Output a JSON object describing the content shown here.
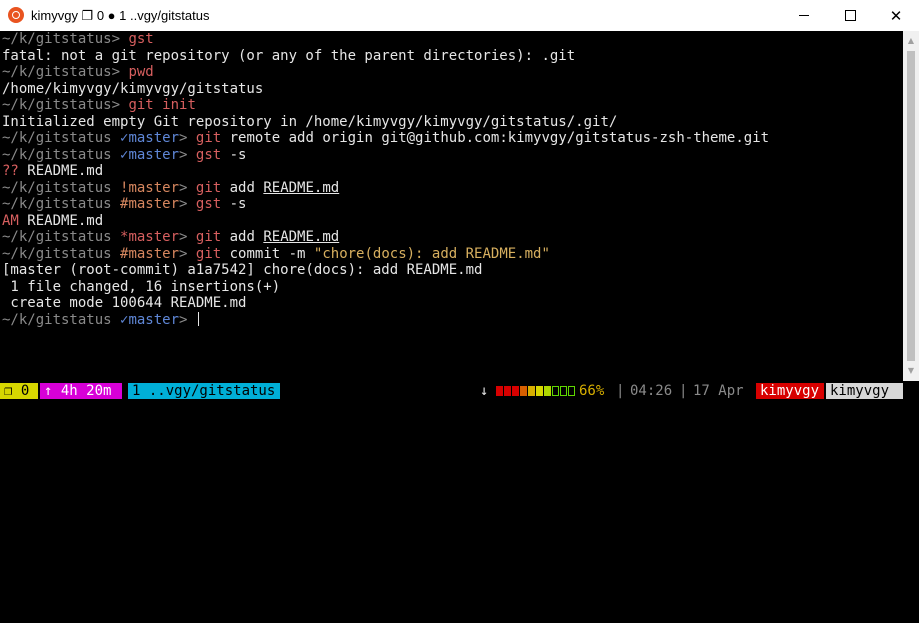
{
  "window": {
    "title": "kimyvgy ❐ 0 ● 1 ..vgy/gitstatus",
    "controls": {
      "minimize": "minimize",
      "maximize": "maximize",
      "close": "✕"
    }
  },
  "terminal": {
    "lines": [
      {
        "prompt": "~/k/gitstatus",
        "branch_mark": "",
        "branch": "",
        "sep": "> ",
        "cmd": "gst",
        "rest": ""
      },
      {
        "text": "fatal: not a git repository (or any of the parent directories): .git"
      },
      {
        "prompt": "~/k/gitstatus",
        "branch_mark": "",
        "branch": "",
        "sep": "> ",
        "cmd": "pwd",
        "rest": ""
      },
      {
        "text": "/home/kimyvgy/kimyvgy/gitstatus"
      },
      {
        "prompt": "~/k/gitstatus",
        "branch_mark": "",
        "branch": "",
        "sep": "> ",
        "cmd": "git init",
        "rest": ""
      },
      {
        "text": "Initialized empty Git repository in /home/kimyvgy/kimyvgy/gitstatus/.git/"
      },
      {
        "prompt": "~/k/gitstatus ",
        "branch_mark": "✓",
        "branch": "master",
        "sep": "> ",
        "cmd": "git",
        "rest": " remote add origin git@github.com:kimyvgy/gitstatus-zsh-theme.git"
      },
      {
        "prompt": "~/k/gitstatus ",
        "branch_mark": "✓",
        "branch": "master",
        "sep": "> ",
        "cmd": "gst",
        "rest": " -s"
      },
      {
        "status_code": "??",
        "file": " README.md"
      },
      {
        "prompt": "~/k/gitstatus ",
        "branch_mark": "!",
        "branch": "master",
        "sep": "> ",
        "cmd": "git",
        "rest": " add ",
        "arg": "README.md"
      },
      {
        "prompt": "~/k/gitstatus ",
        "branch_mark": "#",
        "branch": "master",
        "sep": "> ",
        "cmd": "gst",
        "rest": " -s"
      },
      {
        "status_code": "AM",
        "file": " README.md"
      },
      {
        "prompt": "~/k/gitstatus ",
        "branch_mark": "*",
        "branch": "master",
        "sep": "> ",
        "cmd": "git",
        "rest": " add ",
        "arg": "README.md"
      },
      {
        "prompt": "~/k/gitstatus ",
        "branch_mark": "#",
        "branch": "master",
        "sep": "> ",
        "cmd": "git",
        "rest": " commit -m ",
        "str": "\"chore(docs): add README.md\""
      },
      {
        "text": "[master (root-commit) a1a7542] chore(docs): add README.md"
      },
      {
        "text": " 1 file changed, 16 insertions(+)"
      },
      {
        "text": " create mode 100644 README.md"
      },
      {
        "prompt": "~/k/gitstatus ",
        "branch_mark": "✓",
        "branch": "master",
        "sep": "> ",
        "cmd": "",
        "rest": "",
        "cursor": true
      }
    ]
  },
  "scrollbar": {
    "up": "▲",
    "down": "▼"
  },
  "tmux": {
    "session": "❐ 0",
    "uptime": "↑ 4h 20m",
    "window": "1 ..vgy/gitstatus",
    "download_arrow": "↓",
    "battery_percent": "66%",
    "battery_level": 0.66,
    "separator1": "|",
    "time": "04:26",
    "separator2": "|",
    "date": "17 Apr",
    "user": "kimyvgy",
    "host": "kimyvgy"
  },
  "colors": {
    "session_bg": "#d7d700",
    "uptime_bg": "#d700d7",
    "window_bg": "#00afd7",
    "user_bg": "#d70000",
    "host_bg": "#d7d7d7",
    "battery_colors": [
      "#d70000",
      "#d70000",
      "#d70000",
      "#d75f00",
      "#d7af00",
      "#d7d700",
      "#afd700",
      "#5fd700",
      "#5fd700",
      "#5fd700"
    ]
  }
}
